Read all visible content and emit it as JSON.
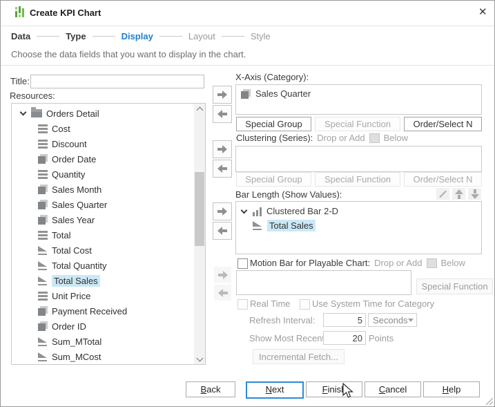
{
  "window": {
    "title": "Create KPI Chart",
    "close_glyph": "✕"
  },
  "steps": {
    "data": "Data",
    "type": "Type",
    "display": "Display",
    "layout": "Layout",
    "style": "Style",
    "active_step": "Display"
  },
  "description": "Choose the data fields that you want to display in the chart.",
  "left": {
    "title_label": "Title:",
    "title_value": "",
    "resources_label": "Resources:",
    "tree_root": "Orders Detail",
    "tree_items": [
      {
        "label": "Cost",
        "icon": "measure-icon",
        "selected": false
      },
      {
        "label": "Discount",
        "icon": "measure-icon",
        "selected": false
      },
      {
        "label": "Order Date",
        "icon": "dimension-icon",
        "selected": false
      },
      {
        "label": "Quantity",
        "icon": "measure-icon",
        "selected": false
      },
      {
        "label": "Sales Month",
        "icon": "dimension-icon",
        "selected": false
      },
      {
        "label": "Sales Quarter",
        "icon": "dimension-icon",
        "selected": false
      },
      {
        "label": "Sales Year",
        "icon": "dimension-icon",
        "selected": false
      },
      {
        "label": "Total",
        "icon": "measure-icon",
        "selected": false
      },
      {
        "label": "Total Cost",
        "icon": "aggregation-icon",
        "selected": false
      },
      {
        "label": "Total Quantity",
        "icon": "aggregation-icon",
        "selected": false
      },
      {
        "label": "Total Sales",
        "icon": "aggregation-icon",
        "selected": true
      },
      {
        "label": "Unit Price",
        "icon": "measure-icon",
        "selected": false
      },
      {
        "label": "Payment Received",
        "icon": "dimension-icon",
        "selected": false
      },
      {
        "label": "Order ID",
        "icon": "dimension-icon",
        "selected": false
      },
      {
        "label": "Sum_MTotal",
        "icon": "aggregation-icon",
        "selected": false
      },
      {
        "label": "Sum_MCost",
        "icon": "aggregation-icon",
        "selected": false
      }
    ]
  },
  "xaxis": {
    "label": "X-Axis (Category):",
    "item": "Sales Quarter",
    "special_group": "Special Group",
    "special_function": "Special Function",
    "order_select": "Order/Select N"
  },
  "clustering": {
    "label": "Clustering (Series):",
    "hint_drop": "Drop or Add",
    "hint_below": "Below",
    "special_group": "Special Group",
    "special_function": "Special Function",
    "order_select": "Order/Select N"
  },
  "bar_length": {
    "label": "Bar Length (Show Values):",
    "group": "Clustered Bar 2-D",
    "item": "Total Sales"
  },
  "motion": {
    "label": "Motion Bar for Playable Chart:",
    "hint_drop": "Drop or Add",
    "hint_below": "Below",
    "special_function": "Special Function",
    "real_time": "Real Time",
    "use_system_time": "Use System Time for Category"
  },
  "refresh": {
    "interval_label": "Refresh Interval:",
    "interval_value": "5",
    "unit": "Seconds",
    "recent_label": "Show Most Recent:",
    "recent_value": "20",
    "points_label": "Points",
    "incremental": "Incremental Fetch..."
  },
  "footer": {
    "back": "Back",
    "next": "Next",
    "finish": "Finish",
    "cancel": "Cancel",
    "help": "Help"
  },
  "colors": {
    "accent_blue": "#1b7fd0",
    "selection_blue": "#cbe8f6",
    "logo_green": "#5fae3c"
  }
}
